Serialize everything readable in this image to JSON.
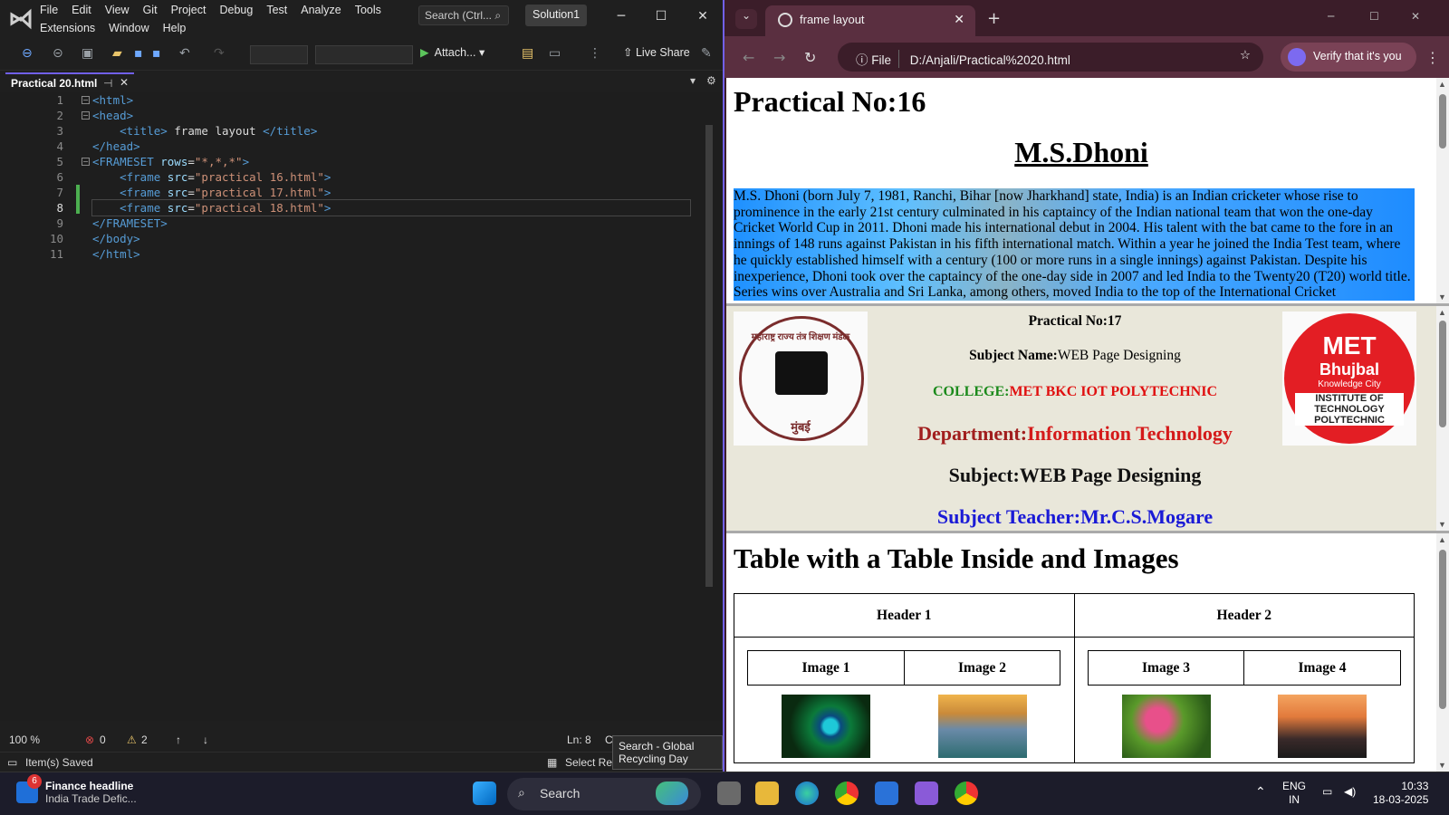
{
  "vs": {
    "menu": [
      "File",
      "Edit",
      "View",
      "Git",
      "Project",
      "Debug",
      "Test",
      "Analyze",
      "Tools",
      "Extensions",
      "Window",
      "Help"
    ],
    "search": "Search (Ctrl...",
    "solution": "Solution1",
    "attach": "Attach...",
    "liveshare": "Live Share",
    "tab": "Practical 20.html",
    "lines": [
      "1",
      "2",
      "3",
      "4",
      "5",
      "6",
      "7",
      "8",
      "9",
      "10",
      "11"
    ],
    "code": {
      "l1": "<html>",
      "l2": "<head>",
      "l3a": "<title>",
      "l3b": " frame layout ",
      "l3c": "</title>",
      "l4": "</head>",
      "l5a": "<FRAMESET",
      "l5b": " rows",
      "l5c": "=",
      "l5d": "\"*,*,*\"",
      "l5e": ">",
      "f_tag": "<frame",
      "f_attr": " src",
      "f_eq": "=",
      "l6": "\"practical 16.html\"",
      "l7": "\"practical 17.html\"",
      "l8": "\"practical 18.html\"",
      "f_end": ">",
      "l9": "</FRAMESET>",
      "l10": "</body>",
      "l11": "</html>"
    },
    "zoom": "100 %",
    "errors": "0",
    "warnings": "2",
    "ln": "Ln: 8",
    "col_partial": "C",
    "status": "Item(s) Saved",
    "repo": "Select Repository",
    "tooltip": "Search - Global Recycling Day"
  },
  "browser": {
    "tab_title": "frame layout",
    "file_chip": "File",
    "url": "D:/Anjali/Practical%2020.html",
    "verify": "Verify that it's you",
    "frame1": {
      "heading": "Practical No:16",
      "name": "M.S.Dhoni",
      "bio": "M.S. Dhoni (born July 7, 1981, Ranchi, Bihar [now Jharkhand] state, India) is an Indian cricketer whose rise to prominence in the early 21st century culminated in his captaincy of the Indian national team that won the one-day Cricket World Cup in 2011. Dhoni made his international debut in 2004. His talent with the bat came to the fore in an innings of 148 runs against Pakistan in his fifth international match. Within a year he joined the India Test team, where he quickly established himself with a century (100 or more runs in a single innings) against Pakistan. Despite his inexperience, Dhoni took over the captaincy of the one-day side in 2007 and led India to the Twenty20 (T20) world title. Series wins over Australia and Sri Lanka, among others, moved India to the top of the International Cricket"
    },
    "frame2": {
      "practical_label": "Practical No:17",
      "subject_label": "Subject Name:",
      "subject_value": "WEB Page Designing",
      "college_label": "COLLEGE:",
      "college_value": "MET BKC IOT POLYTECHNIC",
      "dept_label": "Department:",
      "dept_value": "Information Technology",
      "subject2": "Subject:WEB Page Designing",
      "teacher": "Subject Teacher:Mr.C.S.Mogare",
      "logo_r": [
        "MET",
        "Bhujbal",
        "Knowledge City",
        "INSTITUTE OF",
        "TECHNOLOGY",
        "POLYTECHNIC"
      ],
      "logo_l_bottom": "मुंबई",
      "logo_l_top": "महाराष्ट्र राज्य तंत्र शिक्षण मंडळ"
    },
    "frame3": {
      "heading": "Table with a Table Inside and Images",
      "headers": [
        "Header 1",
        "Header 2"
      ],
      "images": [
        "Image 1",
        "Image 2",
        "Image 3",
        "Image 4"
      ]
    }
  },
  "taskbar": {
    "news_title": "Finance headline",
    "news_sub": "India Trade Defic...",
    "news_badge": "6",
    "search": "Search",
    "lang1": "ENG",
    "lang2": "IN",
    "time": "10:33",
    "date": "18-03-2025"
  },
  "colors": {
    "vs_accent": "#7160e8",
    "browser_chrome": "#5a2f40",
    "logo_red": "#e31e24"
  }
}
